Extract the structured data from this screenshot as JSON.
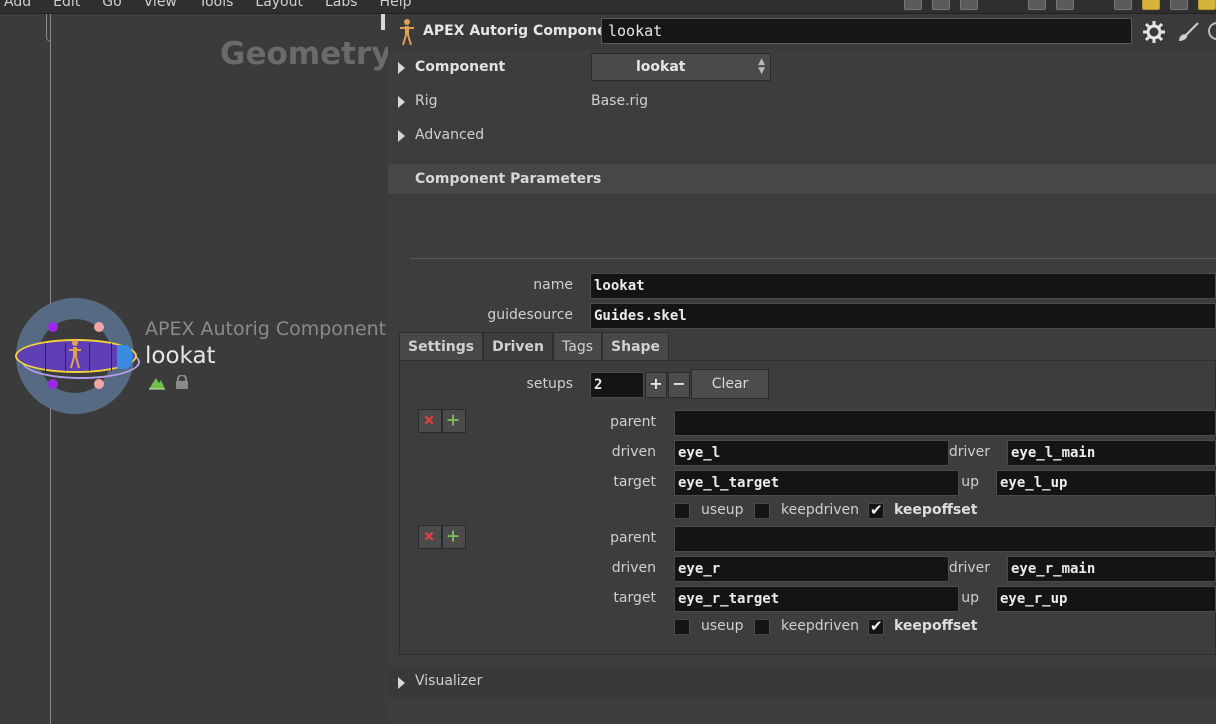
{
  "menubar": {
    "items": [
      "Add",
      "Edit",
      "Go",
      "View",
      "Tools",
      "Layout",
      "Labs",
      "Help"
    ]
  },
  "network": {
    "context_title": "Geometry",
    "node": {
      "type_label": "APEX Autorig Component",
      "name": "lookat"
    }
  },
  "header": {
    "node_type": "APEX Autorig Component",
    "node_name": "lookat"
  },
  "folders": {
    "component": {
      "label": "Component",
      "value": "lookat"
    },
    "rig": {
      "label": "Rig",
      "value": "Base.rig"
    },
    "advanced": {
      "label": "Advanced"
    },
    "component_parameters": {
      "label": "Component Parameters"
    },
    "visualizer": {
      "label": "Visualizer"
    }
  },
  "params": {
    "name": {
      "label": "name",
      "value": "lookat"
    },
    "guidesource": {
      "label": "guidesource",
      "value": "Guides.skel"
    }
  },
  "tabs": [
    {
      "label": "Settings",
      "active": false
    },
    {
      "label": "Driven",
      "active": true
    },
    {
      "label": "Tags",
      "active": false
    },
    {
      "label": "Shape",
      "active": false
    }
  ],
  "driven": {
    "setups_label": "setups",
    "setups_value": "2",
    "plus_label": "+",
    "minus_label": "−",
    "clear_label": "Clear",
    "labels": {
      "parent": "parent",
      "driven": "driven",
      "driver": "driver",
      "target": "target",
      "up": "up",
      "useup": "useup",
      "keepdriven": "keepdriven",
      "keepoffset": "keepoffset"
    },
    "setups": [
      {
        "parent": "",
        "driven": "eye_l",
        "driver": "eye_l_main",
        "target": "eye_l_target",
        "up": "eye_l_up",
        "useup": false,
        "keepdriven": false,
        "keepoffset": true
      },
      {
        "parent": "",
        "driven": "eye_r",
        "driver": "eye_r_main",
        "target": "eye_r_target",
        "up": "eye_r_up",
        "useup": false,
        "keepdriven": false,
        "keepoffset": true
      }
    ]
  },
  "icons": {
    "gear": "gear-icon",
    "brush": "brush-icon",
    "remove": "close-icon",
    "insert": "insert-icon"
  }
}
